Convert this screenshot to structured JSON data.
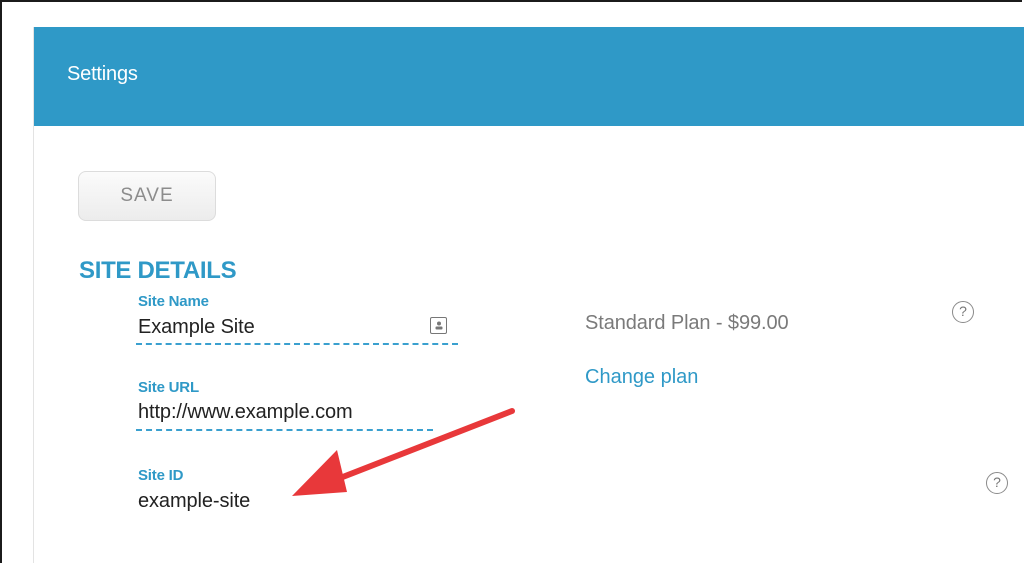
{
  "header": {
    "title": "Settings"
  },
  "toolbar": {
    "save_label": "SAVE"
  },
  "site_details": {
    "section_title": "SITE DETAILS",
    "site_name": {
      "label": "Site Name",
      "value": "Example Site"
    },
    "site_url": {
      "label": "Site URL",
      "value": "http://www.example.com"
    },
    "site_id": {
      "label": "Site ID",
      "value": "example-site"
    }
  },
  "plan": {
    "text": "Standard Plan - $99.00",
    "change_label": "Change plan"
  },
  "help": {
    "glyph": "?"
  },
  "colors": {
    "accent": "#2f99c7",
    "annotation_arrow": "#e8383a"
  },
  "icons": {
    "contact": "contact-card-icon",
    "help": "question-circle-icon",
    "annotation": "red-arrow-annotation"
  }
}
